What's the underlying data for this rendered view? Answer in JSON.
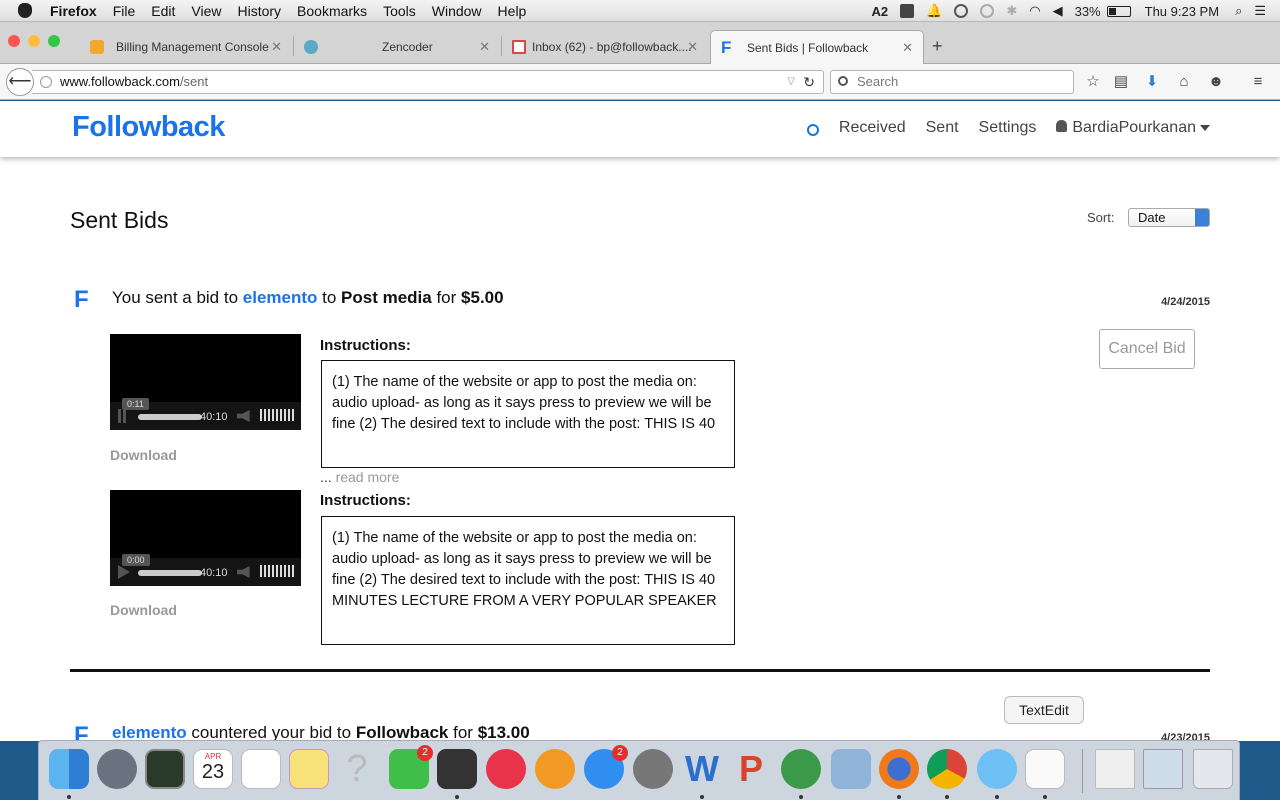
{
  "menubar": {
    "app": "Firefox",
    "items": [
      "File",
      "Edit",
      "View",
      "History",
      "Bookmarks",
      "Tools",
      "Window",
      "Help"
    ],
    "status": {
      "adobe": "2",
      "battery": "33%",
      "clock": "Thu 9:23 PM"
    }
  },
  "tabs": [
    {
      "title": "Billing Management Console",
      "favicon": "aws-box-icon"
    },
    {
      "title": "Zencoder",
      "favicon": "zencoder-icon"
    },
    {
      "title": "Inbox (62) - bp@followback....",
      "favicon": "gmail-icon"
    },
    {
      "title": "Sent Bids  |  Followback",
      "favicon": "followback-icon",
      "active": true
    }
  ],
  "navbar": {
    "url_host": "www.followback.com",
    "url_path": "/sent",
    "search_placeholder": "Search"
  },
  "site": {
    "logo": "Followback",
    "nav": {
      "received": "Received",
      "sent": "Sent",
      "settings": "Settings",
      "user": "BardiaPourkanan"
    }
  },
  "page": {
    "title": "Sent Bids",
    "sort_label": "Sort:",
    "sort_value": "Date"
  },
  "bids": [
    {
      "prefix": "You sent a bid to ",
      "user": "elemento",
      "middle": " to ",
      "action": "Post media",
      "for_text": " for ",
      "amount": "$5.00",
      "date": "4/24/2015",
      "cancel_label": "Cancel Bid",
      "media": [
        {
          "tooltip": "0:11",
          "duration": "40:10",
          "download": "Download",
          "instructions_label": "Instructions:",
          "instructions": "(1) The name of the website or app to post the media on: audio upload- as long as it says press to preview we will be fine (2) The desired text to include with the post: THIS IS 40",
          "read_more_dots": "...",
          "read_more": "read more"
        },
        {
          "tooltip": "0:00",
          "duration": "40:10",
          "download": "Download",
          "instructions_label": "Instructions:",
          "instructions": "(1) The name of the website or app to post the media on: audio upload- as long as it says press to preview we will be fine (2) The desired text to include with the post: THIS IS 40 MINUTES LECTURE FROM A VERY POPULAR SPEAKER"
        }
      ]
    },
    {
      "user": "elemento",
      "middle": " countered your bid to ",
      "action": "Followback",
      "for_text": " for ",
      "amount": "$13.00",
      "date": "4/23/2015"
    }
  ],
  "dock": {
    "tooltip": "TextEdit",
    "calendar_month": "APR",
    "calendar_day": "23",
    "badges": {
      "facetime": "2",
      "appstore": "2"
    }
  }
}
